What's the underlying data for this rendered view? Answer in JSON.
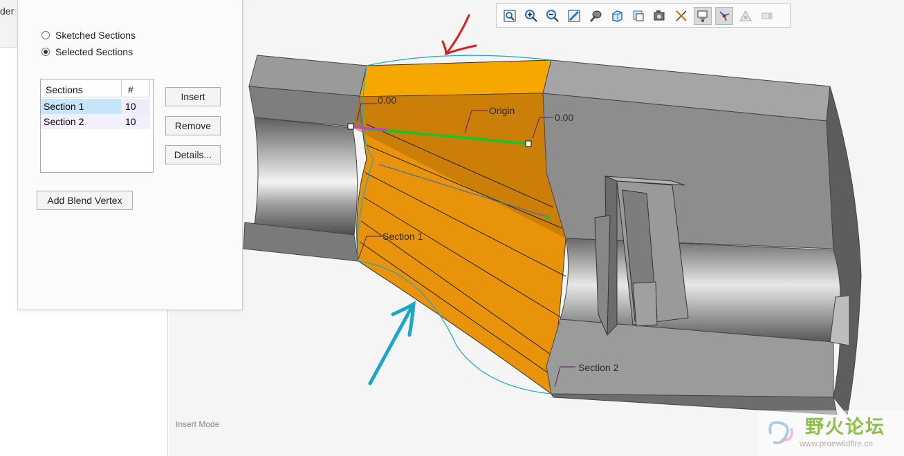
{
  "left_tab": {
    "label": "der"
  },
  "viewport": {
    "mode_label": "Insert Mode"
  },
  "toolbar": {
    "icons": [
      "zoom-refit-icon",
      "zoom-in-icon",
      "zoom-out-icon",
      "repaint-icon",
      "display-style-icon",
      "saved-orientations-icon",
      "view-manager-icon",
      "perspective-view-icon",
      "datum-display-filter-icon",
      "annotation-display-icon",
      "spin-center-icon",
      "appearance-icon",
      "hide-icon"
    ]
  },
  "panel": {
    "radio_sketched": "Sketched Sections",
    "radio_selected": "Selected Sections",
    "selected_option": "Selected Sections",
    "table": {
      "col_sections": "Sections",
      "col_count": "#",
      "rows": [
        {
          "name": "Section 1",
          "count": "10"
        },
        {
          "name": "Section 2",
          "count": "10"
        }
      ]
    },
    "insert_button": "Insert",
    "remove_button": "Remove",
    "details_button": "Details...",
    "add_blend_vertex_button": "Add Blend Vertex"
  },
  "model_labels": {
    "dim_left": "0.00",
    "dim_right": "0.00",
    "origin": "Origin",
    "section1": "Section 1",
    "section2": "Section 2"
  },
  "watermark": {
    "chinese": "野火论坛",
    "url": "www.proewildfire.cn"
  },
  "colors": {
    "blend_orange": "#e8930a",
    "blend_top": "#f7a800",
    "body_gray": "#8e8e8e",
    "annotation_blue": "#1aa7c9",
    "annotation_red": "#d42020",
    "dim_purple": "#5a1a6a"
  }
}
